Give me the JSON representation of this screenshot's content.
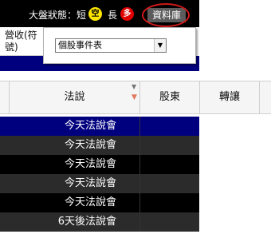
{
  "topbar": {
    "status_label": "大盤狀態：短",
    "short_badge": "空",
    "long_label": "長",
    "long_badge": "多",
    "db_button": "資料庫"
  },
  "left_column": {
    "revenue_label": "營收(符號)"
  },
  "popup": {
    "selected_option": "個股事件表",
    "arrow_icon": "chevron-down-icon"
  },
  "table": {
    "headers": [
      "",
      "法說",
      "股東",
      "轉讓",
      ""
    ],
    "rows": [
      {
        "law": "今天法說會",
        "bg": "#00007f"
      },
      {
        "law": "今天法說會",
        "bg": "#2b2b2b"
      },
      {
        "law": "今天法說會",
        "bg": "#000000"
      },
      {
        "law": "今天法說會",
        "bg": "#2b2b2b"
      },
      {
        "law": "今天法說會",
        "bg": "#000000"
      },
      {
        "law": "6天後法說會",
        "bg": "#2b2b2b"
      }
    ]
  },
  "colors": {
    "highlight_blue": "#00007f",
    "annotation_red": "#d01818",
    "short_yellow": "#ffe600",
    "long_red": "#e00000"
  }
}
